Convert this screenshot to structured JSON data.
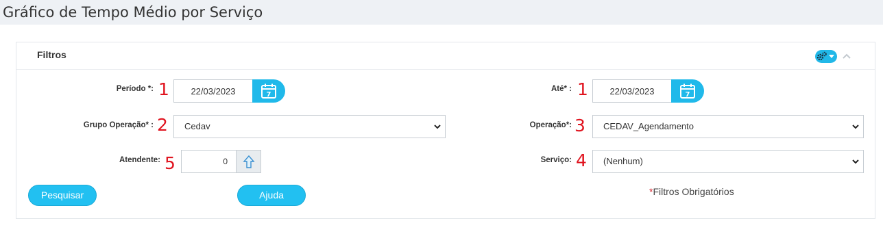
{
  "page": {
    "title": "Gráfico de Tempo Médio por Serviço"
  },
  "panel": {
    "title": "Filtros",
    "tools_icon": "gears-icon",
    "collapse_icon": "chevron-up-icon"
  },
  "form": {
    "periodo": {
      "label": "Período *:",
      "value": "22/03/2023",
      "marker": "1"
    },
    "ate": {
      "label": "Até* :",
      "value": "22/03/2023",
      "marker": "1"
    },
    "grupo_operacao": {
      "label": "Grupo Operação* :",
      "selected": "Cedav",
      "marker": "2"
    },
    "operacao": {
      "label": "Operação*:",
      "selected": "CEDAV_Agendamento",
      "marker": "3"
    },
    "atendente": {
      "label": "Atendente:",
      "value": "0",
      "marker": "5"
    },
    "servico": {
      "label": "Serviço:",
      "selected": "(Nenhum)",
      "marker": "4"
    }
  },
  "buttons": {
    "search": "Pesquisar",
    "help": "Ajuda"
  },
  "required_note": {
    "star": "*",
    "text": "Filtros Obrigatórios"
  },
  "colors": {
    "accent": "#22c0f1",
    "marker": "#e0141f",
    "header_bg": "#eef1f5"
  }
}
